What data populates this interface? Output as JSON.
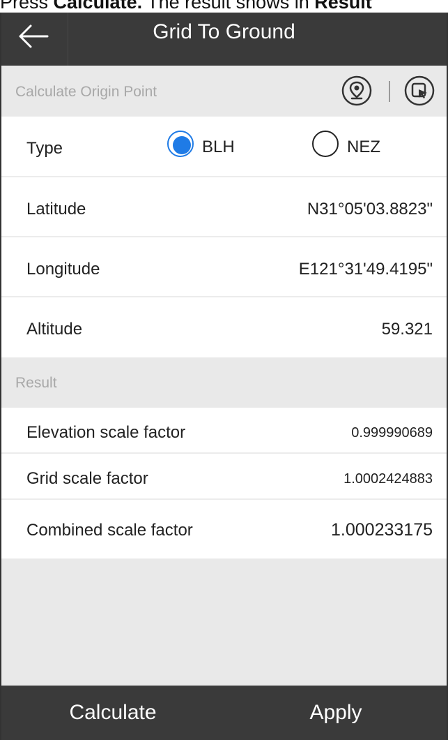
{
  "caption": {
    "prefix": "Press ",
    "bold1": "Calculate.",
    "middle": " The result shows in ",
    "bold2": "Result"
  },
  "header": {
    "back_icon": "arrow-left-icon",
    "title": "Grid To Ground"
  },
  "origin_section": {
    "label": "Calculate Origin Point",
    "icons": [
      "map-pin-icon",
      "select-point-icon"
    ]
  },
  "type": {
    "label": "Type",
    "options": [
      "BLH",
      "NEZ"
    ],
    "selected": "BLH",
    "accent": "#1f7be6"
  },
  "fields": {
    "latitude": {
      "label": "Latitude",
      "value": "N31°05'03.8823\""
    },
    "longitude": {
      "label": "Longitude",
      "value": "E121°31'49.4195\""
    },
    "altitude": {
      "label": "Altitude",
      "value": "59.321"
    }
  },
  "result": {
    "label": "Result",
    "elevation_scale_factor": {
      "label": "Elevation scale factor",
      "value": "0.999990689"
    },
    "grid_scale_factor": {
      "label": "Grid scale factor",
      "value": "1.0002424883"
    },
    "combined_scale_factor": {
      "label": "Combined scale factor",
      "value": "1.000233175"
    }
  },
  "footer": {
    "calculate_label": "Calculate",
    "apply_label": "Apply"
  },
  "colors": {
    "bar": "#3a3a3a",
    "section_bg": "#e9e9e9"
  }
}
